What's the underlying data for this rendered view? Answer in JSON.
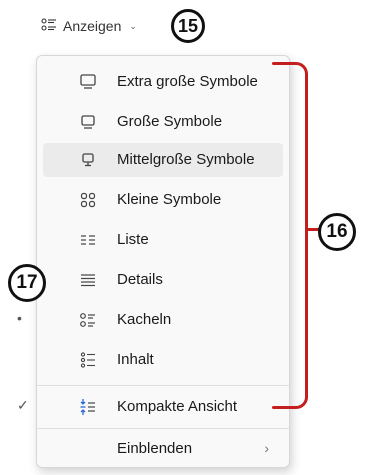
{
  "toolbar": {
    "view_button_label": "Anzeigen",
    "view_button_icon": "tiles-icon",
    "view_button_chevron": "⌄"
  },
  "badges": {
    "b15": "15",
    "b16": "16",
    "b17": "17"
  },
  "menu": {
    "items": [
      {
        "label": "Extra große Symbole",
        "icon": "monitor-large-icon"
      },
      {
        "label": "Große Symbole",
        "icon": "monitor-icon"
      },
      {
        "label": "Mittelgroße Symbole",
        "icon": "monitor-medium-icon",
        "highlighted": true
      },
      {
        "label": "Kleine Symbole",
        "icon": "grid-small-icon"
      },
      {
        "label": "Liste",
        "icon": "list-icon"
      },
      {
        "label": "Details",
        "icon": "details-icon"
      },
      {
        "label": "Kacheln",
        "icon": "tiles-icon",
        "selected": true
      },
      {
        "label": "Inhalt",
        "icon": "content-icon"
      },
      {
        "label": "Kompakte Ansicht",
        "icon": "compact-view-icon",
        "checked": true
      },
      {
        "label": "Einblenden",
        "icon": "",
        "submenu": true
      }
    ],
    "selected_marker": "•",
    "checked_marker": "✓",
    "submenu_chevron": "›"
  },
  "colors": {
    "annotation_red": "#c41e1e",
    "menu_bg": "#f9f9f9",
    "hover_bg": "#ebebeb"
  }
}
